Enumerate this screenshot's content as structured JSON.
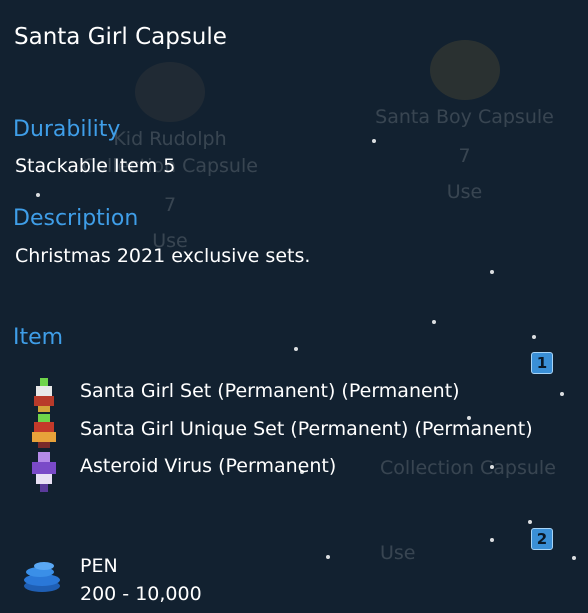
{
  "background": {
    "items": [
      {
        "title": "Kid Rudolph Collection Capsule",
        "count": "7",
        "use": "Use"
      },
      {
        "title": "Santa Boy Capsule",
        "count": "7",
        "use": "Use"
      },
      {
        "title": "Collection Capsule",
        "count": "",
        "use": "Use"
      }
    ]
  },
  "tooltip": {
    "title": "Santa Girl Capsule",
    "durability_heading": "Durability",
    "durability_value": "Stackable Item 5",
    "description_heading": "Description",
    "description_value": "Christmas 2021 exclusive sets.",
    "item_heading": "Item",
    "groups": [
      {
        "badge": "1",
        "entries": [
          "Santa Girl Set (Permanent) (Permanent)",
          "Santa Girl Unique Set (Permanent) (Permanent)",
          "Asteroid Virus (Permanent)"
        ]
      },
      {
        "badge": "2",
        "currency_label": "PEN",
        "currency_range": "200 - 10,000"
      }
    ]
  },
  "colors": {
    "background": "#122130",
    "heading": "#3f9ee8",
    "text": "#ffffff",
    "badge": "#3a8fd6"
  },
  "icons": [
    "santa-girl-set-icon",
    "santa-girl-unique-set-icon",
    "asteroid-virus-icon",
    "pen-coins-icon"
  ]
}
